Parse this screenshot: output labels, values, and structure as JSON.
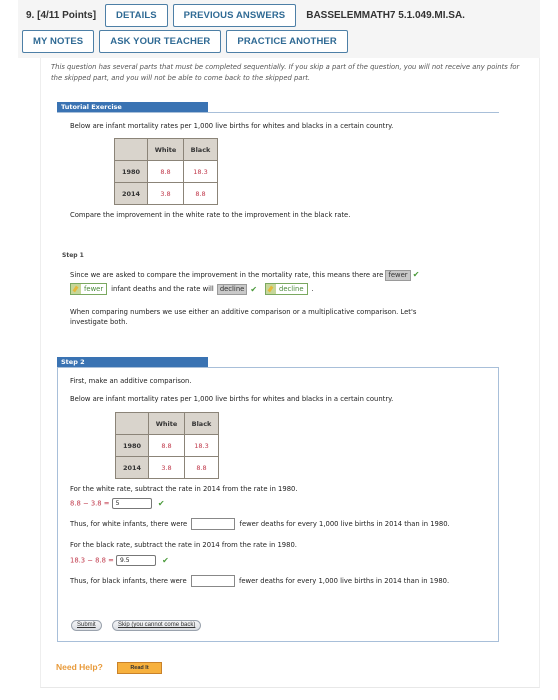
{
  "header": {
    "question_label": "9. [4/11 Points]",
    "details_label": "DETAILS",
    "previous_answers_label": "PREVIOUS ANSWERS",
    "question_code": "BASSELEMMATH7 5.1.049.MI.SA.",
    "my_notes_label": "MY NOTES",
    "ask_teacher_label": "ASK YOUR TEACHER",
    "practice_another_label": "PRACTICE ANOTHER"
  },
  "note": "This question has several parts that must be completed sequentially. If you skip a part of the question, you will not receive any points for the skipped part, and you will not be able to come back to the skipped part.",
  "tutorial": {
    "title": "Tutorial Exercise",
    "intro": "Below are infant mortality rates per 1,000 live births for whites and blacks in a certain country.",
    "table": {
      "columns": [
        "",
        "White",
        "Black"
      ],
      "rows": [
        {
          "year": "1980",
          "white": "8.8",
          "black": "18.3"
        },
        {
          "year": "2014",
          "white": "3.8",
          "black": "8.8"
        }
      ]
    },
    "prompt": "Compare the improvement in the white rate to the improvement in the black rate."
  },
  "step1": {
    "title": "Step 1",
    "line1_text": "Since we are asked to compare the improvement in the mortality rate, this means there are",
    "selected1": "fewer",
    "answer1": "fewer",
    "line2_mid": "infant deaths and the rate will",
    "selected2": "decline",
    "answer2": "decline",
    "line2_end": ".",
    "para": "When comparing numbers we use either an additive comparison or a multiplicative comparison. Let's",
    "para2": "investigate both."
  },
  "step2": {
    "title": "Step 2",
    "intro": "First, make an additive comparison.",
    "table_intro": "Below are infant mortality rates per 1,000 live births for whites and blacks in a certain country.",
    "table": {
      "rows": [
        {
          "year": "1980",
          "white": "8.8",
          "black": "18.3"
        },
        {
          "year": "2014",
          "white": "3.8",
          "black": "8.8"
        }
      ],
      "columns": [
        "",
        "White",
        "Black"
      ]
    },
    "white_instr": "For the white rate, subtract the rate in 2014 from the rate in 1980.",
    "white_expr": "8.8 − 3.8 =",
    "white_answer": "5",
    "white_thus_pre": "Thus, for white infants, there were",
    "white_thus_post": "fewer deaths for every 1,000 live births in 2014 than in 1980.",
    "white_thus_value": "",
    "black_instr": "For the black rate, subtract the rate in 2014 from the rate in 1980.",
    "black_expr": "18.3 − 8.8 =",
    "black_answer": "9.5",
    "black_thus_pre": "Thus, for black infants, there were",
    "black_thus_post": "fewer deaths for every 1,000 live births in 2014 than in 1980.",
    "black_thus_value": "",
    "submit_label": "Submit",
    "skip_label": "Skip (you cannot come back)"
  },
  "help": {
    "label": "Need Help?",
    "read_it_label": "Read It"
  },
  "icons": {
    "check": "✔"
  }
}
